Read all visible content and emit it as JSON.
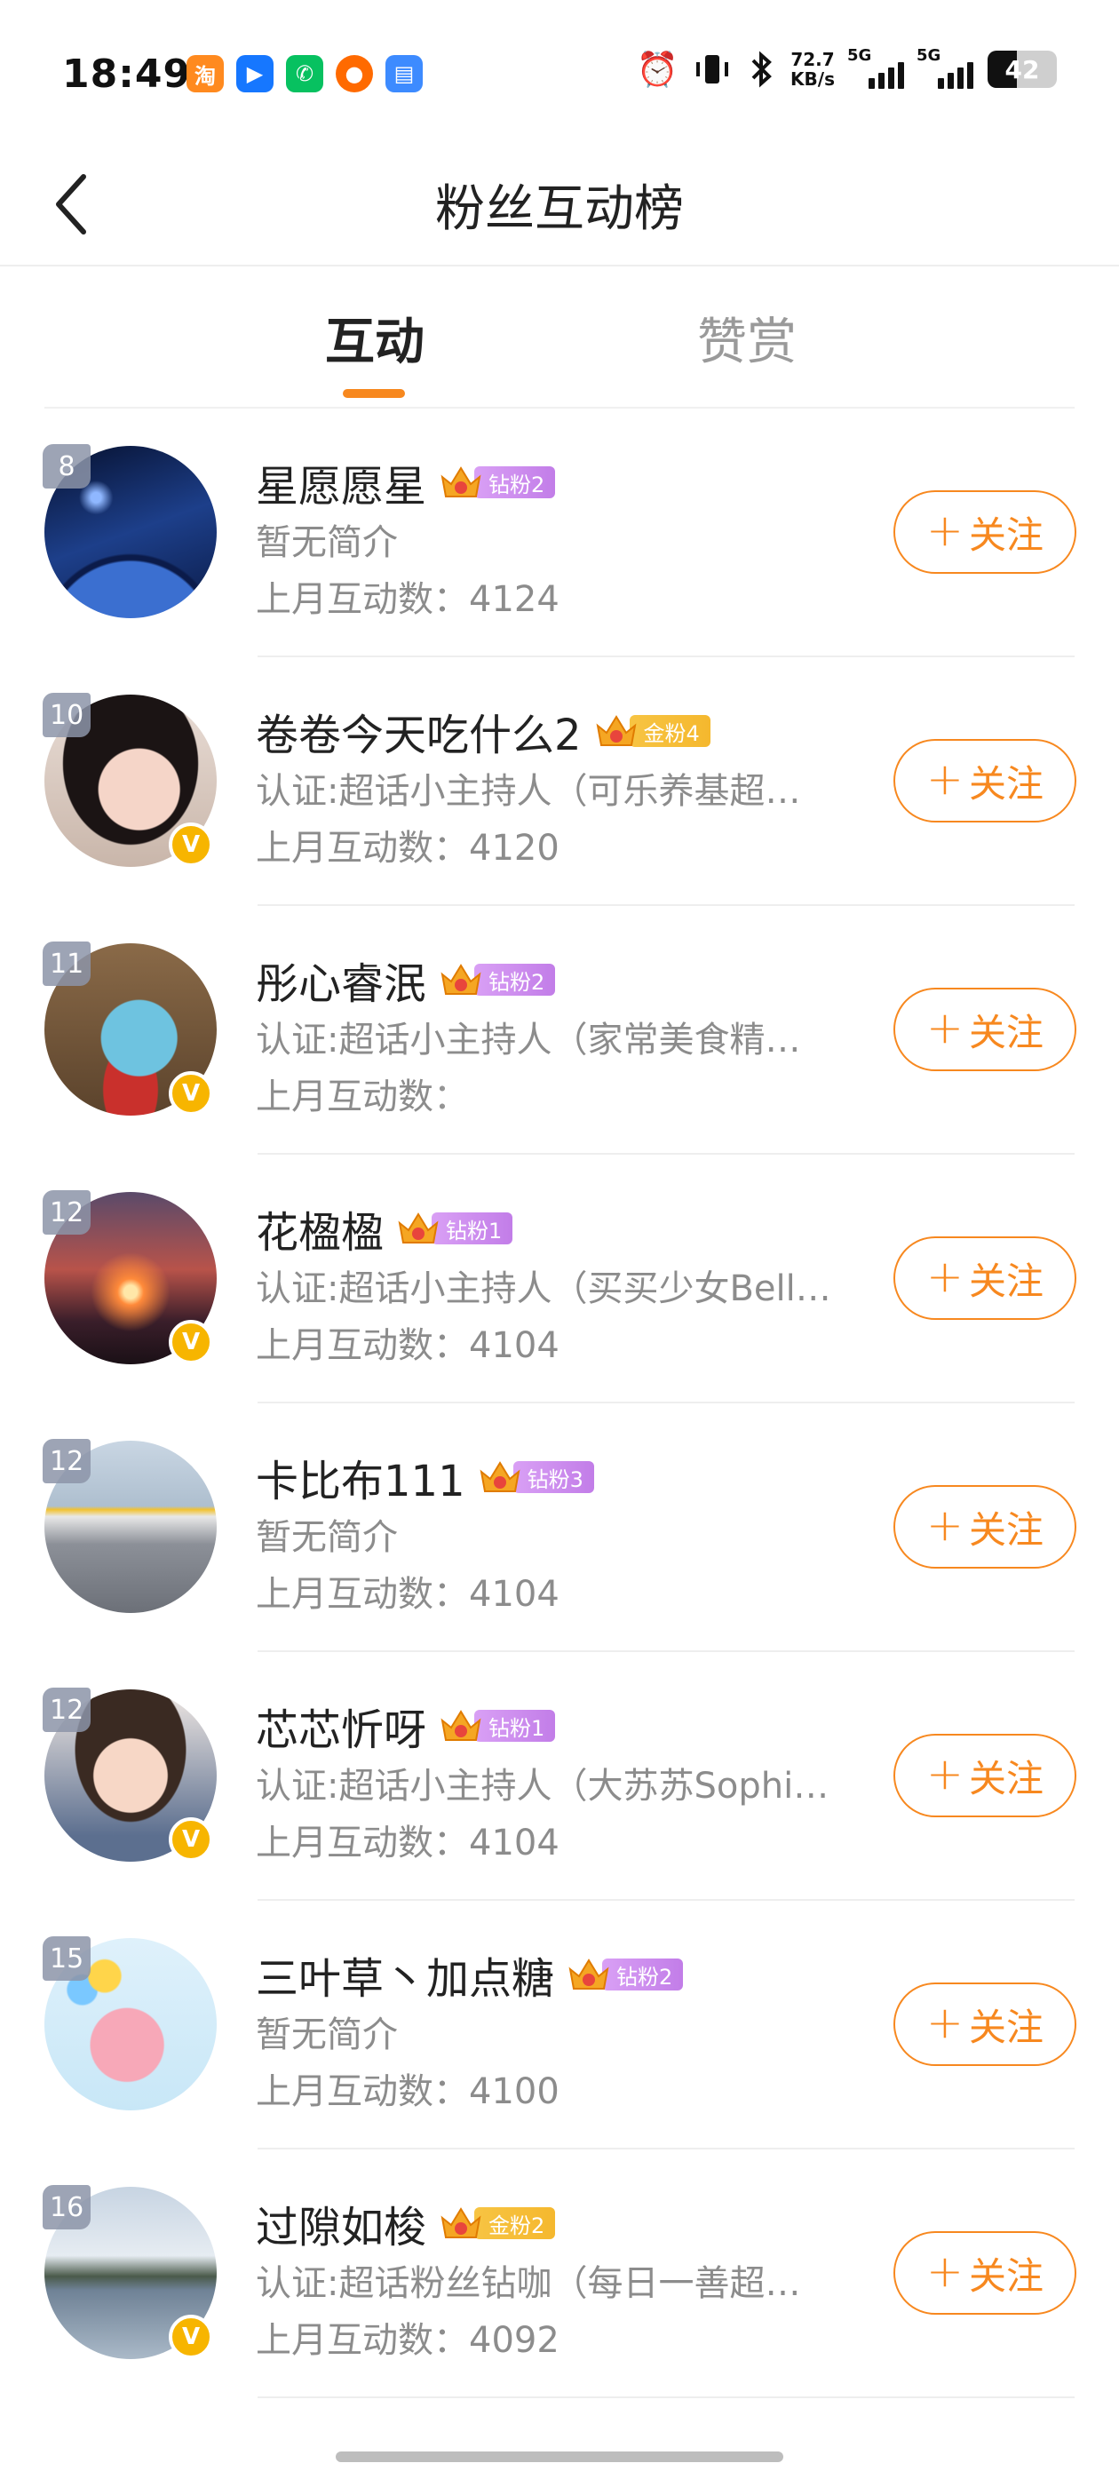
{
  "status_bar": {
    "time": "18:49",
    "net_speed_value": "72.7",
    "net_speed_unit": "KB/s",
    "network_1": "5G",
    "network_2": "5G",
    "battery": "42",
    "battery_level": 0.42,
    "app_icons": [
      "taobao-icon",
      "tools-icon",
      "wechat-icon",
      "app-icon",
      "files-icon"
    ]
  },
  "header": {
    "title": "粉丝互动榜"
  },
  "tabs": [
    {
      "label": "互动",
      "active": true
    },
    {
      "label": "赞赏",
      "active": false
    }
  ],
  "follow_label": "关注",
  "count_prefix": "上月互动数：",
  "users": [
    {
      "rank": "8",
      "name": "星愿愿星",
      "fan_level": "钻粉2",
      "badge_type": "diamond",
      "intro": "暂无简介",
      "count": "4124",
      "verified": false,
      "avatar": "starry-night"
    },
    {
      "rank": "10",
      "name": "卷卷今天吃什么2",
      "fan_level": "金粉4",
      "badge_type": "gold",
      "intro": "认证:超话小主持人（可乐养基超…",
      "count": "4120",
      "verified": true,
      "avatar": "girl-portrait"
    },
    {
      "rank": "11",
      "name": "彤心睿泯",
      "fan_level": "钻粉2",
      "badge_type": "diamond",
      "intro": "认证:超话小主持人（家常美食精…",
      "count": "",
      "count_masked": true,
      "verified": true,
      "avatar": "lucky-cat"
    },
    {
      "rank": "12",
      "name": "花楹楹",
      "fan_level": "钻粉1",
      "badge_type": "diamond",
      "intro": "认证:超话小主持人（买买少女Bell…",
      "count": "4104",
      "verified": true,
      "avatar": "sunset"
    },
    {
      "rank": "12",
      "name": "卡比布111",
      "fan_level": "钻粉3",
      "badge_type": "diamond",
      "intro": "暂无简介",
      "count": "4104",
      "verified": false,
      "avatar": "airport"
    },
    {
      "rank": "12",
      "name": "芯芯忻呀",
      "fan_level": "钻粉1",
      "badge_type": "diamond",
      "intro": "认证:超话小主持人（大苏苏Sophi…",
      "count": "4104",
      "verified": true,
      "avatar": "baby"
    },
    {
      "rank": "15",
      "name": "三叶草丶加点糖",
      "fan_level": "钻粉2",
      "badge_type": "diamond",
      "intro": "暂无简介",
      "count": "4100",
      "verified": false,
      "avatar": "cartoon-pig"
    },
    {
      "rank": "16",
      "name": "过隙如梭",
      "fan_level": "金粉2",
      "badge_type": "gold",
      "intro": "认证:超话粉丝钻咖（每日一善超…",
      "count": "4092",
      "verified": true,
      "avatar": "lake-landscape"
    }
  ],
  "colors": {
    "accent": "#f7881f",
    "diamond_badge": "#c27de8",
    "gold_badge": "#f5b82e",
    "verified": "#f7b500"
  }
}
